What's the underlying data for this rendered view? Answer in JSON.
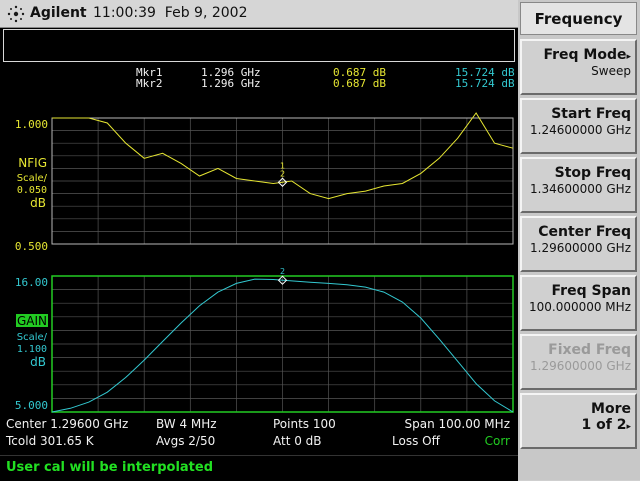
{
  "header": {
    "brand": "Agilent",
    "time": "11:00:39",
    "date": "Feb 9, 2002"
  },
  "markers": [
    {
      "name": "Mkr1",
      "freq": "1.296 GHz",
      "nfig": "0.687 dB",
      "gain": "15.724 dB"
    },
    {
      "name": "Mkr2",
      "freq": "1.296 GHz",
      "nfig": "0.687 dB",
      "gain": "15.724 dB"
    }
  ],
  "upper_graph": {
    "top_label": "1.000",
    "bottom_label": "0.500",
    "param": "NFIG",
    "scale_label": "Scale/",
    "scale_value": "0.050",
    "unit": "dB",
    "color": "#e6e632",
    "marker_labels": [
      "1",
      "2"
    ]
  },
  "lower_graph": {
    "top_label": "16.00",
    "bottom_label": "5.000",
    "param": "GAIN",
    "scale_label": "Scale/",
    "scale_value": "1.100",
    "unit": "dB",
    "color": "#33c8d0",
    "frame_color": "#22cc22",
    "marker_labels": [
      "2"
    ]
  },
  "footer": {
    "row1": {
      "center": "Center 1.29600 GHz",
      "bw": "BW 4 MHz",
      "points": "Points 100",
      "span": "Span 100.00 MHz"
    },
    "row2": {
      "tcold": "Tcold 301.65 K",
      "avgs": "Avgs 2/50",
      "att": "Att 0 dB",
      "loss": "Loss Off",
      "corr": "Corr"
    }
  },
  "status_message": "User cal will be interpolated",
  "softkeys": {
    "title": "Frequency",
    "items": [
      {
        "label": "Freq Mode",
        "value": "Sweep",
        "has_arrow": true,
        "enabled": true
      },
      {
        "label": "Start Freq",
        "value": "1.24600000 GHz",
        "enabled": true
      },
      {
        "label": "Stop Freq",
        "value": "1.34600000 GHz",
        "enabled": true
      },
      {
        "label": "Center Freq",
        "value": "1.29600000 GHz",
        "enabled": true
      },
      {
        "label": "Freq Span",
        "value": "100.000000 MHz",
        "enabled": true
      },
      {
        "label": "Fixed Freq",
        "value": "1.29600000 GHz",
        "enabled": false
      },
      {
        "label": "More",
        "value": "1 of 2",
        "has_arrow": true,
        "enabled": true
      }
    ]
  },
  "chart_data": [
    {
      "type": "line",
      "parameter": "NFIG",
      "unit": "dB",
      "ylim": [
        0.5,
        1.0
      ],
      "xlim_ghz": [
        1.246,
        1.346
      ],
      "series": [
        {
          "name": "NFIG",
          "x": [
            1.246,
            1.25,
            1.254,
            1.258,
            1.262,
            1.266,
            1.27,
            1.274,
            1.278,
            1.282,
            1.286,
            1.29,
            1.294,
            1.298,
            1.302,
            1.306,
            1.31,
            1.314,
            1.318,
            1.322,
            1.326,
            1.33,
            1.334,
            1.338,
            1.342,
            1.346
          ],
          "y": [
            1.0,
            1.0,
            1.0,
            0.98,
            0.9,
            0.84,
            0.86,
            0.82,
            0.77,
            0.8,
            0.76,
            0.75,
            0.74,
            0.75,
            0.7,
            0.68,
            0.7,
            0.71,
            0.73,
            0.74,
            0.78,
            0.84,
            0.92,
            1.02,
            0.9,
            0.88
          ]
        }
      ]
    },
    {
      "type": "line",
      "parameter": "GAIN",
      "unit": "dB",
      "ylim": [
        5.0,
        16.0
      ],
      "xlim_ghz": [
        1.246,
        1.346
      ],
      "series": [
        {
          "name": "GAIN",
          "x": [
            1.246,
            1.25,
            1.254,
            1.258,
            1.262,
            1.266,
            1.27,
            1.274,
            1.278,
            1.282,
            1.286,
            1.29,
            1.294,
            1.298,
            1.302,
            1.306,
            1.31,
            1.314,
            1.318,
            1.322,
            1.326,
            1.33,
            1.334,
            1.338,
            1.342,
            1.346
          ],
          "y": [
            5.0,
            5.3,
            5.8,
            6.6,
            7.8,
            9.2,
            10.7,
            12.2,
            13.6,
            14.7,
            15.4,
            15.75,
            15.72,
            15.6,
            15.5,
            15.4,
            15.3,
            15.1,
            14.7,
            13.9,
            12.6,
            10.9,
            9.1,
            7.3,
            5.9,
            5.0
          ]
        }
      ]
    }
  ]
}
